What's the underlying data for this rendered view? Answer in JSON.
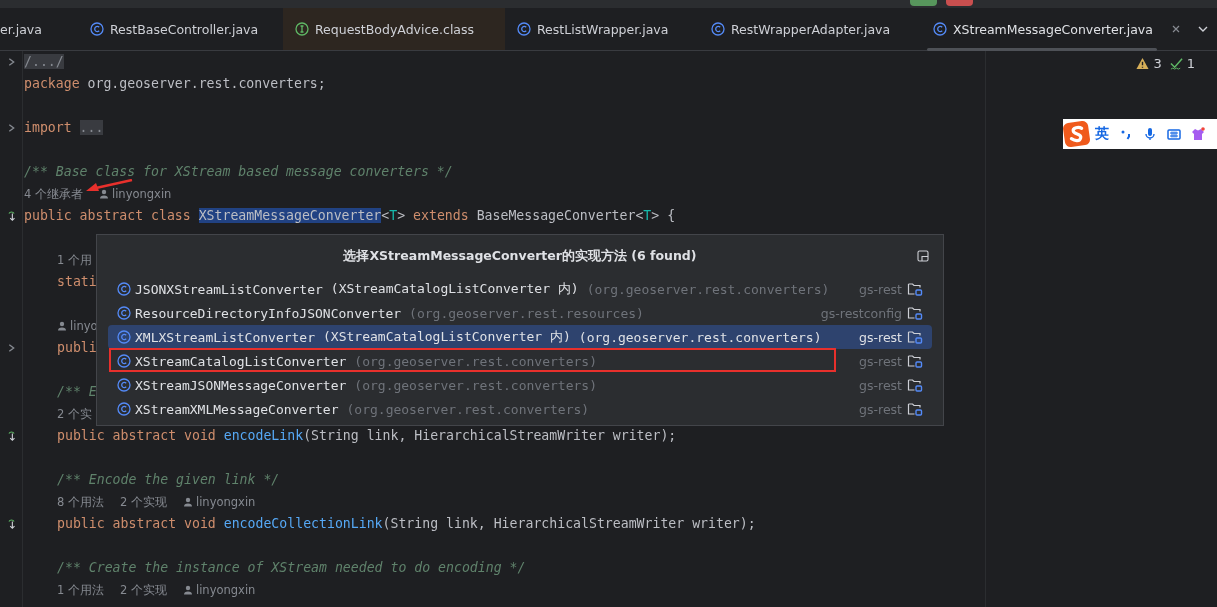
{
  "tabs": [
    {
      "label": "er.java",
      "kind": "plain",
      "selected": false,
      "tinted": false
    },
    {
      "label": "RestBaseController.java",
      "kind": "class",
      "selected": false,
      "tinted": false
    },
    {
      "label": "RequestBodyAdvice.class",
      "kind": "interface",
      "selected": false,
      "tinted": true
    },
    {
      "label": "RestListWrapper.java",
      "kind": "class",
      "selected": false,
      "tinted": false
    },
    {
      "label": "RestWrapperAdapter.java",
      "kind": "class",
      "selected": false,
      "tinted": false
    },
    {
      "label": "XStreamMessageConverter.java",
      "kind": "class",
      "selected": true,
      "tinted": false
    }
  ],
  "inspections": {
    "warnings": "3",
    "checks": "1"
  },
  "ime_toolbar": {
    "mode": "英"
  },
  "lines": [
    {
      "kind": "code",
      "nested": false,
      "foldable": true,
      "implemented": false,
      "segments": [
        {
          "kind": "fold",
          "text": "/.../"
        }
      ]
    },
    {
      "kind": "code",
      "nested": false,
      "foldable": false,
      "implemented": false,
      "segments": [
        {
          "kind": "kw",
          "text": "package "
        },
        {
          "kind": "plain",
          "text": "org.geoserver.rest.converters;"
        }
      ]
    },
    {
      "kind": "blank"
    },
    {
      "kind": "code",
      "nested": false,
      "foldable": true,
      "implemented": false,
      "segments": [
        {
          "kind": "kw",
          "text": "import "
        },
        {
          "kind": "fold",
          "text": "..."
        }
      ]
    },
    {
      "kind": "blank"
    },
    {
      "kind": "code",
      "nested": false,
      "foldable": false,
      "implemented": false,
      "segments": [
        {
          "kind": "comment",
          "text": "/** Base class for XStream based message converters */"
        }
      ]
    },
    {
      "kind": "hint",
      "nested": false,
      "items": [
        {
          "kind": "count",
          "text": "4 个继承者",
          "pointed_at": true
        },
        {
          "kind": "author",
          "text": "linyongxin"
        }
      ]
    },
    {
      "kind": "code",
      "nested": false,
      "foldable": false,
      "implemented": true,
      "segments": [
        {
          "kind": "kw",
          "text": "public abstract class "
        },
        {
          "kind": "sel",
          "text": "XStreamMessageConverter"
        },
        {
          "kind": "plain",
          "text": "<"
        },
        {
          "kind": "tparam",
          "text": "T"
        },
        {
          "kind": "plain",
          "text": "> "
        },
        {
          "kind": "kw",
          "text": "extends "
        },
        {
          "kind": "plain",
          "text": "BaseMessageConverter<"
        },
        {
          "kind": "tparam",
          "text": "T"
        },
        {
          "kind": "plain",
          "text": "> {"
        }
      ]
    },
    {
      "kind": "blank"
    },
    {
      "kind": "hint",
      "nested": true,
      "items": [
        {
          "kind": "count",
          "text": "1 个用"
        }
      ]
    },
    {
      "kind": "code",
      "nested": true,
      "foldable": false,
      "implemented": false,
      "segments": [
        {
          "kind": "kw",
          "text": "stati"
        }
      ]
    },
    {
      "kind": "blank"
    },
    {
      "kind": "hint",
      "nested": true,
      "items": [
        {
          "kind": "author",
          "text": "linyo"
        }
      ]
    },
    {
      "kind": "code",
      "nested": true,
      "foldable": true,
      "implemented": false,
      "segments": [
        {
          "kind": "kw",
          "text": "publi"
        }
      ]
    },
    {
      "kind": "blank"
    },
    {
      "kind": "code",
      "nested": true,
      "foldable": false,
      "implemented": false,
      "segments": [
        {
          "kind": "comment",
          "text": "/** E"
        }
      ]
    },
    {
      "kind": "hint",
      "nested": true,
      "items": [
        {
          "kind": "count",
          "text": "2 个实"
        }
      ]
    },
    {
      "kind": "code",
      "nested": true,
      "foldable": false,
      "implemented": true,
      "segments": [
        {
          "kind": "kw",
          "text": "public abstract void "
        },
        {
          "kind": "method",
          "text": "encodeLink"
        },
        {
          "kind": "plain",
          "text": "(String link, HierarchicalStreamWriter writer);"
        }
      ]
    },
    {
      "kind": "blank"
    },
    {
      "kind": "code",
      "nested": true,
      "foldable": false,
      "implemented": false,
      "segments": [
        {
          "kind": "comment",
          "text": "/** Encode the given link */"
        }
      ]
    },
    {
      "kind": "hint",
      "nested": true,
      "items": [
        {
          "kind": "count",
          "text": "8 个用法"
        },
        {
          "kind": "count",
          "text": "2 个实现"
        },
        {
          "kind": "author",
          "text": "linyongxin"
        }
      ]
    },
    {
      "kind": "code",
      "nested": true,
      "foldable": false,
      "implemented": true,
      "segments": [
        {
          "kind": "kw",
          "text": "public abstract void "
        },
        {
          "kind": "method",
          "text": "encodeCollectionLink"
        },
        {
          "kind": "plain",
          "text": "(String link, HierarchicalStreamWriter writer);"
        }
      ]
    },
    {
      "kind": "blank"
    },
    {
      "kind": "code",
      "nested": true,
      "foldable": false,
      "implemented": false,
      "segments": [
        {
          "kind": "comment",
          "text": "/** Create the instance of XStream needed to do encoding */"
        }
      ]
    },
    {
      "kind": "hint",
      "nested": true,
      "items": [
        {
          "kind": "count",
          "text": "1 个用法"
        },
        {
          "kind": "count",
          "text": "2 个实现"
        },
        {
          "kind": "author",
          "text": "linyongxin"
        }
      ]
    }
  ],
  "popup": {
    "title": "选择XStreamMessageConverter的实现方法 (6 found)",
    "items": [
      {
        "name": "JSONXStreamListConverter",
        "container": "(XStreamCatalogListConverter 内)",
        "package": "(org.geoserver.rest.converters)",
        "module": "gs-rest",
        "selected": false,
        "marked": false
      },
      {
        "name": "ResourceDirectoryInfoJSONConverter",
        "package": "(org.geoserver.rest.resources)",
        "module": "gs-restconfig",
        "selected": false,
        "marked": false
      },
      {
        "name": "XMLXStreamListConverter",
        "container": "(XStreamCatalogListConverter 内)",
        "package": "(org.geoserver.rest.converters)",
        "module": "gs-rest",
        "selected": true,
        "marked": false
      },
      {
        "name": "XStreamCatalogListConverter",
        "package": "(org.geoserver.rest.converters)",
        "module": "gs-rest",
        "selected": false,
        "marked": true
      },
      {
        "name": "XStreamJSONMessageConverter",
        "package": "(org.geoserver.rest.converters)",
        "module": "gs-rest",
        "selected": false,
        "marked": false
      },
      {
        "name": "XStreamXMLMessageConverter",
        "package": "(org.geoserver.rest.converters)",
        "module": "gs-rest",
        "selected": false,
        "marked": false
      }
    ]
  }
}
